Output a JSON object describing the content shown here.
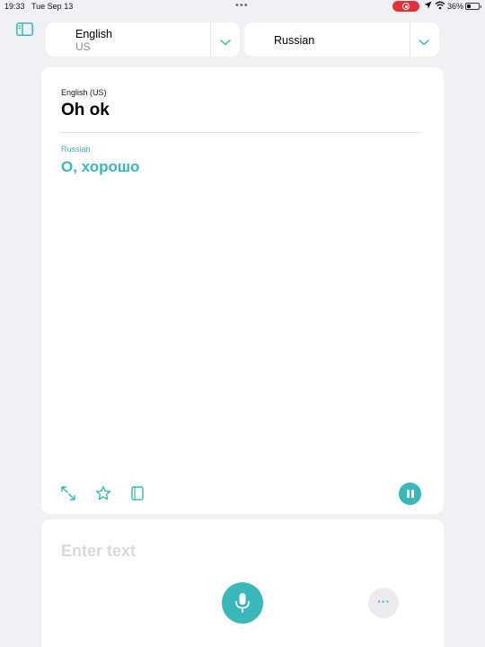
{
  "status_bar": {
    "time": "19:33",
    "date": "Tue Sep 13",
    "battery_percent": "36%",
    "battery_level": 0.36
  },
  "language_selector": {
    "source": {
      "name": "English",
      "region": "US"
    },
    "target": {
      "name": "Russian"
    }
  },
  "translation": {
    "source_label": "English (US)",
    "source_text": "Oh ok",
    "target_label": "Russian",
    "target_text": "О, хорошо"
  },
  "input": {
    "placeholder": "Enter text",
    "value": ""
  },
  "colors": {
    "accent": "#3ab7bb",
    "background": "#f1f0f5",
    "recording": "#e5303a"
  },
  "icons": {
    "sidebar": "sidebar-icon",
    "expand": "expand-arrows-icon",
    "favorite": "star-icon",
    "dictionary": "book-icon",
    "pause": "pause-icon",
    "mic": "microphone-icon",
    "more": "ellipsis-icon"
  },
  "more_button_glyph": "···"
}
